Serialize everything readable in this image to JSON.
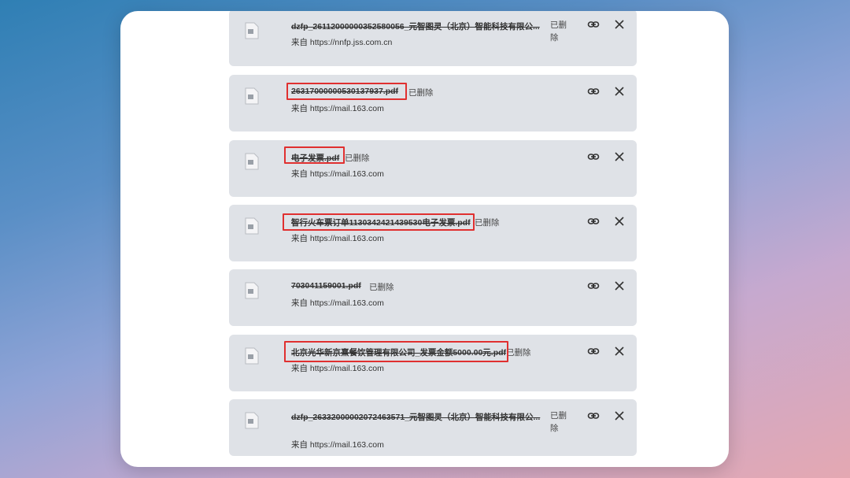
{
  "downloads": [
    {
      "filename": "dzfp_26112000000352580056_元智图灵（北京）智能科技有限公...",
      "status": "已删除",
      "source": "来自 https://nnfp.jss.com.cn",
      "icon": "file-icon",
      "highlighted": false
    },
    {
      "filename": "26317000000530137937.pdf",
      "status": "已删除",
      "source": "来自 https://mail.163.com",
      "icon": "file-icon",
      "highlighted": true
    },
    {
      "filename": "电子发票.pdf",
      "status": "已删除",
      "source": "来自 https://mail.163.com",
      "icon": "file-icon",
      "highlighted": true
    },
    {
      "filename": "智行火车票订单1130342421439530电子发票.pdf",
      "status": "已删除",
      "source": "来自 https://mail.163.com",
      "icon": "file-icon",
      "highlighted": true
    },
    {
      "filename": "703041159001.pdf",
      "status": "已删除",
      "source": "来自 https://mail.163.com",
      "icon": "file-icon",
      "highlighted": false
    },
    {
      "filename": "北京光华新京熹餐饮管理有限公司_发票金额5000.00元.pdf",
      "status": "已删除",
      "source": "来自 https://mail.163.com",
      "icon": "file-icon",
      "highlighted": true
    },
    {
      "filename": "dzfp_26332000002072463571_元智图灵（北京）智能科技有限公...",
      "status": "已删除",
      "source": "来自 https://mail.163.com",
      "icon": "file-icon",
      "highlighted": false
    }
  ],
  "colors": {
    "card_bg": "#dfe2e7",
    "highlight": "#e03030",
    "window_bg": "#ffffff"
  }
}
